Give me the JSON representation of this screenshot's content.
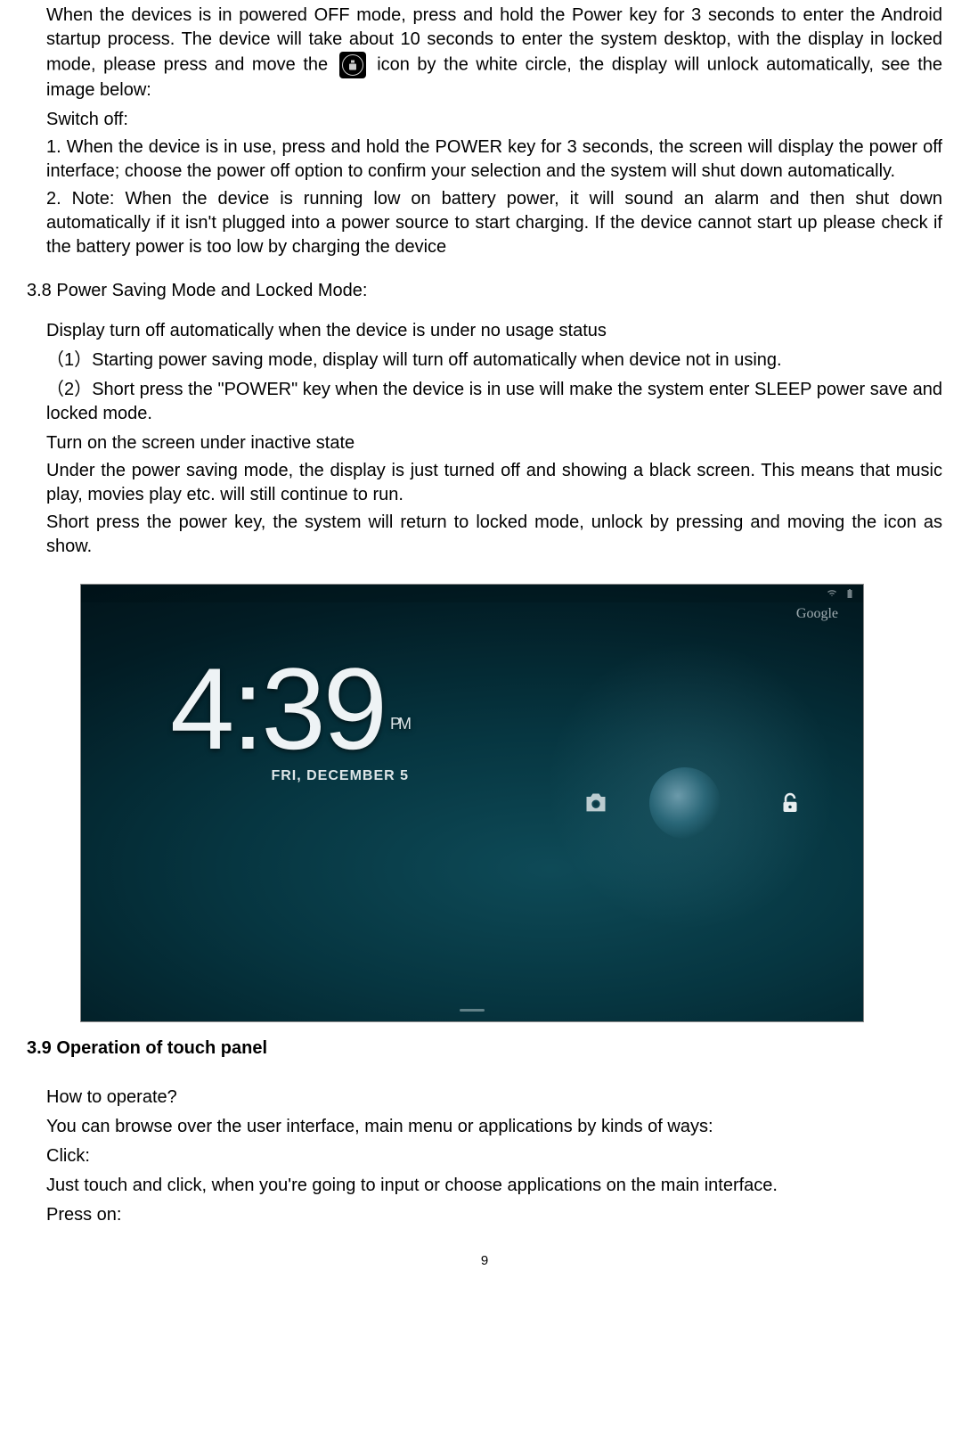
{
  "p1a": "When the devices is in powered OFF mode, press and hold the Power key for 3 seconds to enter the Android startup process. The device will take about 10 seconds to enter the system desktop, with the display in locked mode, please press and move the ",
  "p1b": " icon by the white circle, the display will unlock automatically, see the image below:",
  "switch_off_heading": "Switch off:",
  "p2": "1. When the device is in use, press and hold the POWER key for 3 seconds, the screen will display the power off interface; choose the power off option to confirm your selection and the system will shut down automatically.",
  "p3": "2. Note: When the device is running low on battery power, it will sound an alarm and then shut down automatically if it isn't plugged into a power source to start charging. If the device cannot start up please check if the battery power is too low by charging the device",
  "section38": "3.8 Power Saving Mode and Locked Mode:",
  "p4": "Display turn off automatically when the device is under no usage status",
  "p5": "（1）Starting power saving mode, display will turn off automatically when device not in using.",
  "p6": "（2）Short press the \"POWER\" key when the device is in use will make the system enter SLEEP power save and locked mode.",
  "p7": "Turn on the screen under inactive state",
  "p8": "Under the power saving mode, the display is just turned off and showing a black screen. This means that music play, movies play etc. will still continue to run.",
  "p9": "Short press the power key, the system will return to locked mode, unlock by pressing and moving the icon as show.",
  "section39": "3.9 Operation of touch panel",
  "p10": "How to operate?",
  "p11": "You can browse over the user interface, main menu or applications by kinds of ways:",
  "p12": "Click:",
  "p13": "Just touch and click, when you're going to input or choose applications on the main interface.",
  "p14": "Press on:",
  "lockscreen": {
    "time": "4:39",
    "ampm": "PM",
    "date": "FRI, DECEMBER 5",
    "google_label": "Google"
  },
  "page_number": "9"
}
